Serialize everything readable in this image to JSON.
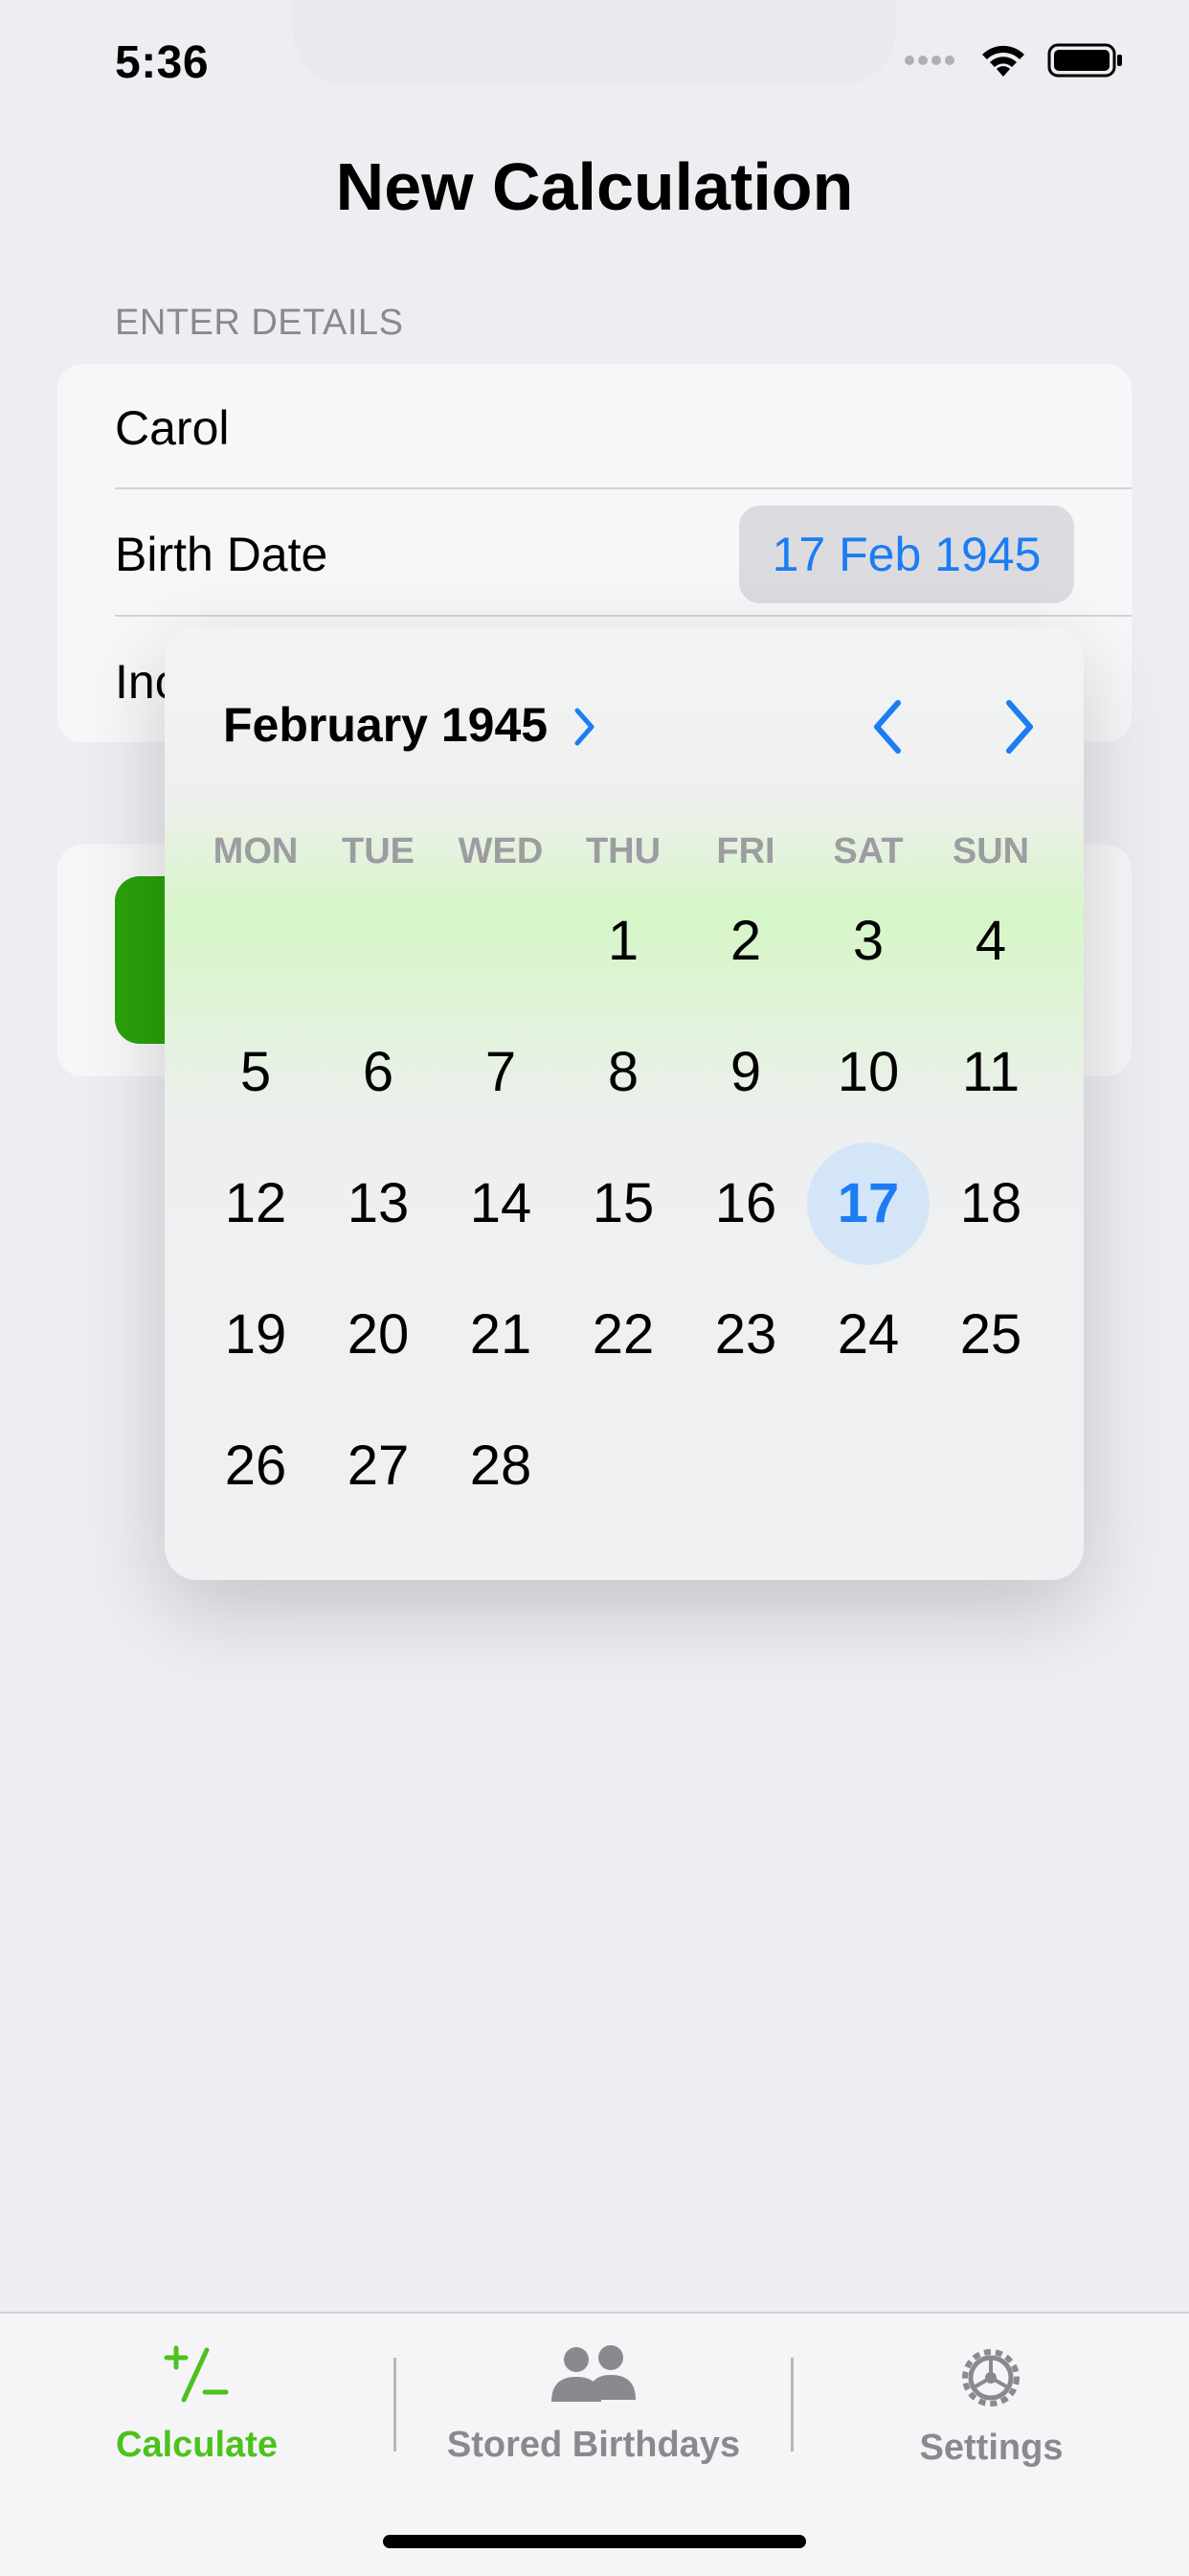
{
  "status_bar": {
    "time": "5:36"
  },
  "page": {
    "title": "New Calculation"
  },
  "form": {
    "section_label": "ENTER DETAILS",
    "name_value": "Carol",
    "birth_date_label": "Birth Date",
    "birth_date_value": "17 Feb 1945",
    "third_row_partial": "Inc"
  },
  "calendar": {
    "month_label": "February 1945",
    "weekdays": [
      "MON",
      "TUE",
      "WED",
      "THU",
      "FRI",
      "SAT",
      "SUN"
    ],
    "weeks": [
      [
        "",
        "",
        "",
        "1",
        "2",
        "3",
        "4"
      ],
      [
        "5",
        "6",
        "7",
        "8",
        "9",
        "10",
        "11"
      ],
      [
        "12",
        "13",
        "14",
        "15",
        "16",
        "17",
        "18"
      ],
      [
        "19",
        "20",
        "21",
        "22",
        "23",
        "24",
        "25"
      ],
      [
        "26",
        "27",
        "28",
        "",
        "",
        "",
        ""
      ]
    ],
    "selected_day": "17"
  },
  "tabbar": {
    "tabs": [
      {
        "label": "Calculate",
        "icon": "plus-minus-icon",
        "active": true
      },
      {
        "label": "Stored Birthdays",
        "icon": "people-icon",
        "active": false
      },
      {
        "label": "Settings",
        "icon": "gear-icon",
        "active": false
      }
    ]
  },
  "colors": {
    "accent_blue": "#1c7cf3",
    "active_tab_green": "#4cc21c",
    "button_green": "#2aa10a",
    "inactive_tab_gray": "#8a8a8e"
  }
}
